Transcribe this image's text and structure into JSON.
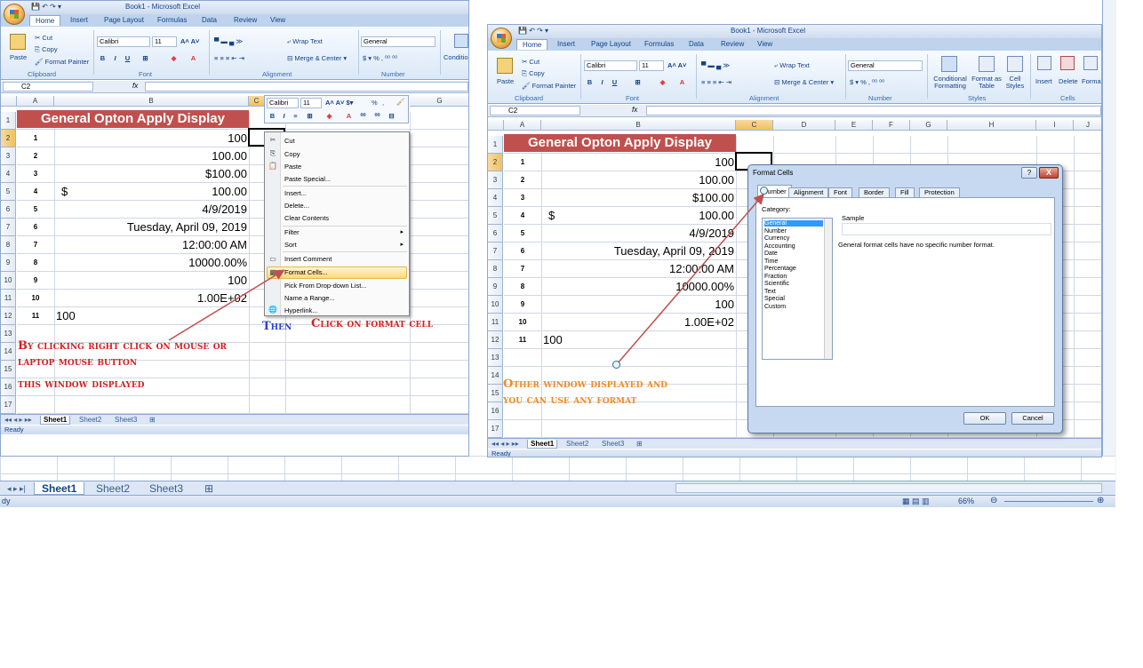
{
  "title": "Book1 - Microsoft Excel",
  "menu": [
    "Home",
    "Insert",
    "Page Layout",
    "Formulas",
    "Data",
    "Review",
    "View"
  ],
  "ribbon": {
    "paste": "Paste",
    "cut": "Cut",
    "copy": "Copy",
    "format_painter": "Format Painter",
    "font_name": "Calibri",
    "font_size": "11",
    "wrap_text": "Wrap Text",
    "merge_center": "Merge & Center",
    "number_format": "General",
    "conditional_formatting": "Conditional Formatting",
    "conditional_short": "Conditio Formattin",
    "format_as_table": "Format as Table",
    "cell_styles": "Cell Styles",
    "insert": "Insert",
    "delete": "Delete",
    "format": "Forma",
    "groups": {
      "clipboard": "Clipboard",
      "font": "Font",
      "alignment": "Alignment",
      "number": "Number",
      "styles": "Styles",
      "cells": "Cells"
    }
  },
  "namebox": "C2",
  "fx": "fx",
  "columns_left": [
    "A",
    "B",
    "C",
    "G"
  ],
  "columns_right": [
    "A",
    "B",
    "C",
    "D",
    "E",
    "F",
    "G",
    "H",
    "I",
    "J"
  ],
  "rows": [
    "1",
    "2",
    "3",
    "4",
    "5",
    "6",
    "7",
    "8",
    "9",
    "10",
    "11",
    "12",
    "13",
    "14",
    "15",
    "16",
    "17"
  ],
  "banner": "General Opton Apply Display",
  "table": [
    {
      "a": "1",
      "b": "100"
    },
    {
      "a": "2",
      "b": "100.00"
    },
    {
      "a": "3",
      "b": "$100.00"
    },
    {
      "a": "4",
      "b": "100.00",
      "prefix": "$"
    },
    {
      "a": "5",
      "b": "4/9/2019"
    },
    {
      "a": "6",
      "b": "Tuesday, April 09, 2019"
    },
    {
      "a": "7",
      "b": "12:00:00 AM"
    },
    {
      "a": "8",
      "b": "10000.00%"
    },
    {
      "a": "9",
      "b": "100"
    },
    {
      "a": "10",
      "b": "1.00E+02"
    },
    {
      "a": "11",
      "b": "100"
    }
  ],
  "sheets": [
    "Sheet1",
    "Sheet2",
    "Sheet3"
  ],
  "status": "Ready",
  "back_status": "dy",
  "zoom": "66%",
  "minibar": {
    "font": "Calibri",
    "size": "11",
    "percent": "%"
  },
  "context_menu": [
    "Cut",
    "Copy",
    "Paste",
    "Paste Special...",
    "Insert...",
    "Delete...",
    "Clear Contents",
    "Filter",
    "Sort",
    "Insert Comment",
    "Format Cells...",
    "Pick From Drop-down List...",
    "Name a Range...",
    "Hyperlink..."
  ],
  "annotations": {
    "left_1": "By clicking right click on mouse or",
    "left_2": "laptop mouse button",
    "left_3": "this window displayed",
    "then": "Then",
    "click": "Click on format cell",
    "right_1": "Other window displayed and",
    "right_2": "you can use any format"
  },
  "dialog": {
    "title": "Format Cells",
    "help": "?",
    "close": "X",
    "tabs": [
      "Number",
      "Alignment",
      "Font",
      "Border",
      "Fill",
      "Protection"
    ],
    "category_label": "Category:",
    "categories": [
      "General",
      "Number",
      "Currency",
      "Accounting",
      "Date",
      "Time",
      "Percentage",
      "Fraction",
      "Scientific",
      "Text",
      "Special",
      "Custom"
    ],
    "sample_label": "Sample",
    "description": "General format cells have no specific number format.",
    "ok": "OK",
    "cancel": "Cancel"
  },
  "colors": {
    "banner": "#c0504d",
    "annotation_red": "#d32020",
    "annotation_blue": "#2f3fd1",
    "annotation_orange": "#f38a1e",
    "ribbon": "#dbe8f7"
  }
}
